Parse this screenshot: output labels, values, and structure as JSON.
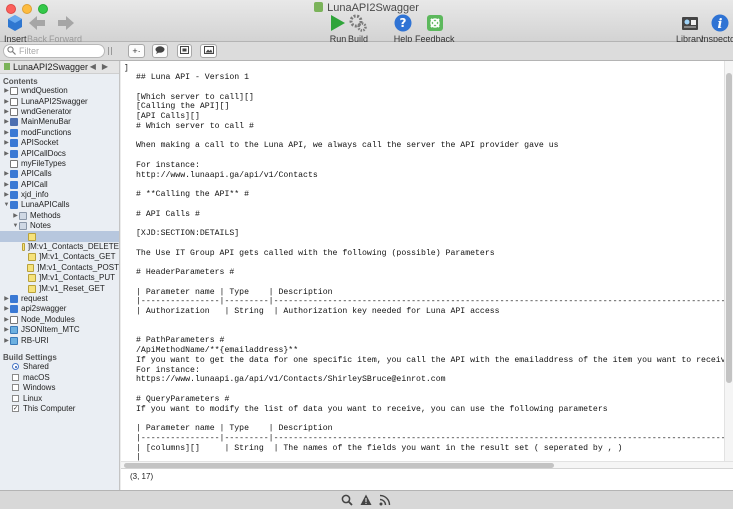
{
  "window": {
    "title": "LunaAPI2Swagger"
  },
  "toolbar": {
    "insert": "Insert",
    "back": "Back",
    "forward": "Forward",
    "run": "Run",
    "build": "Build",
    "help": "Help",
    "feedback": "Feedback",
    "library": "Library",
    "inspector": "Inspector"
  },
  "filter": {
    "placeholder": "Filter"
  },
  "editor_toolbar": {
    "button1": "+·"
  },
  "sidebar": {
    "project": "LunaAPI2Swagger",
    "contents_label": "Contents",
    "items": [
      {
        "label": "wndQuestion",
        "icon": "window-icon",
        "indent": 0,
        "disclosure": "closed"
      },
      {
        "label": "LunaAPI2Swagger",
        "icon": "window-icon",
        "indent": 0,
        "disclosure": "closed"
      },
      {
        "label": "wndGenerator",
        "icon": "window-icon",
        "indent": 0,
        "disclosure": "closed"
      },
      {
        "label": "MainMenuBar",
        "icon": "menubar-icon",
        "indent": 0,
        "disclosure": "closed"
      },
      {
        "label": "modFunctions",
        "icon": "globe-icon",
        "indent": 0,
        "disclosure": "closed"
      },
      {
        "label": "APISocket",
        "icon": "globe-icon",
        "indent": 0,
        "disclosure": "closed"
      },
      {
        "label": "APICallDocs",
        "icon": "globe-icon",
        "indent": 0,
        "disclosure": "closed"
      },
      {
        "label": "myFileTypes",
        "icon": "filetype-icon",
        "indent": 0,
        "disclosure": "none"
      },
      {
        "label": "APICalls",
        "icon": "globe-icon",
        "indent": 0,
        "disclosure": "closed"
      },
      {
        "label": "APICall",
        "icon": "globe-icon",
        "indent": 0,
        "disclosure": "closed"
      },
      {
        "label": "xjd_info",
        "icon": "globe-icon",
        "indent": 0,
        "disclosure": "closed"
      },
      {
        "label": "LunaAPICalls",
        "icon": "globe-icon",
        "indent": 0,
        "disclosure": "open"
      },
      {
        "label": "Methods",
        "icon": "folder-icon",
        "indent": 1,
        "disclosure": "closed"
      },
      {
        "label": "Notes",
        "icon": "folder-icon",
        "indent": 1,
        "disclosure": "open"
      },
      {
        "label": "",
        "icon": "note-icon",
        "indent": 2,
        "disclosure": "none",
        "selected": true
      },
      {
        "label": "]M:v1_Contacts_DELETE",
        "icon": "note-icon",
        "indent": 2,
        "disclosure": "none"
      },
      {
        "label": "]M:v1_Contacts_GET",
        "icon": "note-icon",
        "indent": 2,
        "disclosure": "none"
      },
      {
        "label": "]M:v1_Contacts_POST",
        "icon": "note-icon",
        "indent": 2,
        "disclosure": "none"
      },
      {
        "label": "]M:v1_Contacts_PUT",
        "icon": "note-icon",
        "indent": 2,
        "disclosure": "none"
      },
      {
        "label": "]M:v1_Reset_GET",
        "icon": "note-icon",
        "indent": 2,
        "disclosure": "none"
      },
      {
        "label": "request",
        "icon": "globe-icon",
        "indent": 0,
        "disclosure": "closed"
      },
      {
        "label": "api2swagger",
        "icon": "globe-icon",
        "indent": 0,
        "disclosure": "closed"
      },
      {
        "label": "Node_Modules",
        "icon": "window-icon",
        "indent": 0,
        "disclosure": "closed"
      },
      {
        "label": "JSONItem_MTC",
        "icon": "class-icon",
        "indent": 0,
        "disclosure": "closed"
      },
      {
        "label": "RB-URI",
        "icon": "class-icon",
        "indent": 0,
        "disclosure": "closed"
      }
    ],
    "build_settings_label": "Build Settings",
    "build_settings": [
      {
        "label": "Shared",
        "control": "radio",
        "checked": true
      },
      {
        "label": "macOS",
        "control": "checkbox",
        "checked": false
      },
      {
        "label": "Windows",
        "control": "checkbox",
        "checked": false
      },
      {
        "label": "Linux",
        "control": "checkbox",
        "checked": false
      },
      {
        "label": "This Computer",
        "control": "checkbox",
        "checked": true
      }
    ]
  },
  "editor": {
    "gutter_mark": "]",
    "lines": [
      "## Luna API - Version 1",
      "",
      "[Which server to call][]",
      "[Calling the API][]",
      "[API Calls][]",
      "# Which server to call #",
      "",
      "When making a call to the Luna API, we always call the server the API provider gave us",
      "",
      "For instance:",
      "http://www.lunaapi.ga/api/v1/Contacts",
      "",
      "# **Calling the API** #",
      "",
      "# API Calls #",
      "",
      "[XJD:SECTION:DETAILS]",
      "",
      "The Use IT Group API gets called with the following (possible) Parameters",
      "",
      "# HeaderParameters #",
      "",
      "| Parameter name | Type    | Description",
      "|----------------|---------|--------------------------------------------------------------------------------------------------------",
      "| Authorization   | String  | Authorization key needed for Luna API access",
      "",
      "",
      "# PathParameters #",
      "/ApiMethodName/**{emailaddress}**",
      "If you want to get the data for one specific item, you call the API with the emailaddress of the item you want to receive",
      "For instance:",
      "https://www.lunaapi.ga/api/v1/Contacts/ShirleySBruce@einrot.com",
      "",
      "# QueryParameters #",
      "If you want to modify the list of data you want to receive, you can use the following parameters",
      "",
      "| Parameter name | Type    | Description",
      "|----------------|---------|--------------------------------------------------------------------------------------------------------",
      "| [columns][]     | String  | The names of the fields you want in the result set ( seperated by , )",
      "|"
    ]
  },
  "status": {
    "cursor": "(3, 17)"
  }
}
